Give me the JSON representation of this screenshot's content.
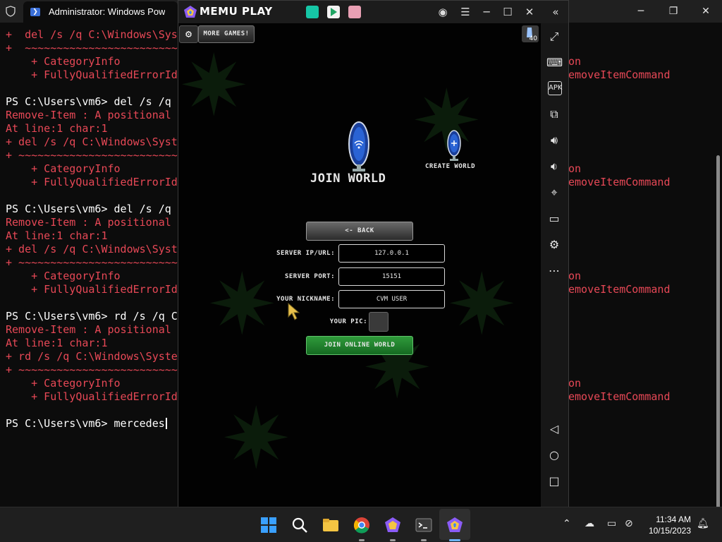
{
  "powershell": {
    "tab_title": "Administrator: Windows PowerShell",
    "lines": [
      {
        "text": "+  del /s /q C:\\Windows\\Syst",
        "cls": "red"
      },
      {
        "text": "+  ~~~~~~~~~~~~~~~~~~~~~~~~~~",
        "cls": "red"
      },
      {
        "text": "    + CategoryInfo",
        "cls": "red"
      },
      {
        "text": "    + FullyQualifiedErrorId",
        "cls": "red"
      },
      {
        "text": "",
        "cls": ""
      },
      {
        "text": "PS C:\\Users\\vm6> del /s /q ",
        "cls": "white"
      },
      {
        "text": "Remove-Item : A positional",
        "cls": "red"
      },
      {
        "text": "At line:1 char:1",
        "cls": "red"
      },
      {
        "text": "+ del /s /q C:\\Windows\\Syst",
        "cls": "red"
      },
      {
        "text": "+ ~~~~~~~~~~~~~~~~~~~~~~~~~~",
        "cls": "red"
      },
      {
        "text": "    + CategoryInfo",
        "cls": "red"
      },
      {
        "text": "    + FullyQualifiedErrorId",
        "cls": "red"
      },
      {
        "text": "",
        "cls": ""
      },
      {
        "text": "PS C:\\Users\\vm6> del /s /q ",
        "cls": "white"
      },
      {
        "text": "Remove-Item : A positional",
        "cls": "red"
      },
      {
        "text": "At line:1 char:1",
        "cls": "red"
      },
      {
        "text": "+ del /s /q C:\\Windows\\Syst",
        "cls": "red"
      },
      {
        "text": "+ ~~~~~~~~~~~~~~~~~~~~~~~~~~",
        "cls": "red"
      },
      {
        "text": "    + CategoryInfo",
        "cls": "red"
      },
      {
        "text": "    + FullyQualifiedErrorId",
        "cls": "red"
      },
      {
        "text": "",
        "cls": ""
      },
      {
        "text": "PS C:\\Users\\vm6> rd /s /q C",
        "cls": "white"
      },
      {
        "text": "Remove-Item : A positional",
        "cls": "red"
      },
      {
        "text": "At line:1 char:1",
        "cls": "red"
      },
      {
        "text": "+ rd /s /q C:\\Windows\\Syste",
        "cls": "red"
      },
      {
        "text": "+ ~~~~~~~~~~~~~~~~~~~~~~~~~~",
        "cls": "red"
      },
      {
        "text": "    + CategoryInfo",
        "cls": "red"
      },
      {
        "text": "    + FullyQualifiedErrorId",
        "cls": "red"
      },
      {
        "text": "",
        "cls": ""
      },
      {
        "text": "PS C:\\Users\\vm6> mercedes",
        "cls": "white"
      }
    ],
    "right_fragments": [
      {
        "line": 2,
        "text": "on"
      },
      {
        "line": 3,
        "text": "emoveItemCommand"
      },
      {
        "line": 10,
        "text": "on"
      },
      {
        "line": 11,
        "text": "emoveItemCommand"
      },
      {
        "line": 18,
        "text": "on"
      },
      {
        "line": 19,
        "text": "emoveItemCommand"
      },
      {
        "line": 26,
        "text": "on"
      },
      {
        "line": 27,
        "text": "emoveItemCommand"
      }
    ]
  },
  "memu": {
    "brand": "MEMU PLAY",
    "badge_level": "40",
    "game": {
      "more_games": "MORE GAMES!",
      "join_world": "JOIN WORLD",
      "create_world": "CREATE WORLD",
      "back": "<- BACK",
      "server_ip_label": "SERVER IP/URL:",
      "server_ip_value": "127.0.0.1",
      "server_port_label": "SERVER PORT:",
      "server_port_value": "15151",
      "nickname_label": "YOUR NICKNAME:",
      "nickname_value": "CVM USER",
      "pic_label": "YOUR PIC:",
      "join_online": "JOIN ONLINE WORLD"
    }
  },
  "taskbar": {
    "time": "11:34 AM",
    "date": "10/15/2023"
  },
  "colors": {
    "terminal_red": "#e74856",
    "accent_green": "#2f9a3a"
  }
}
